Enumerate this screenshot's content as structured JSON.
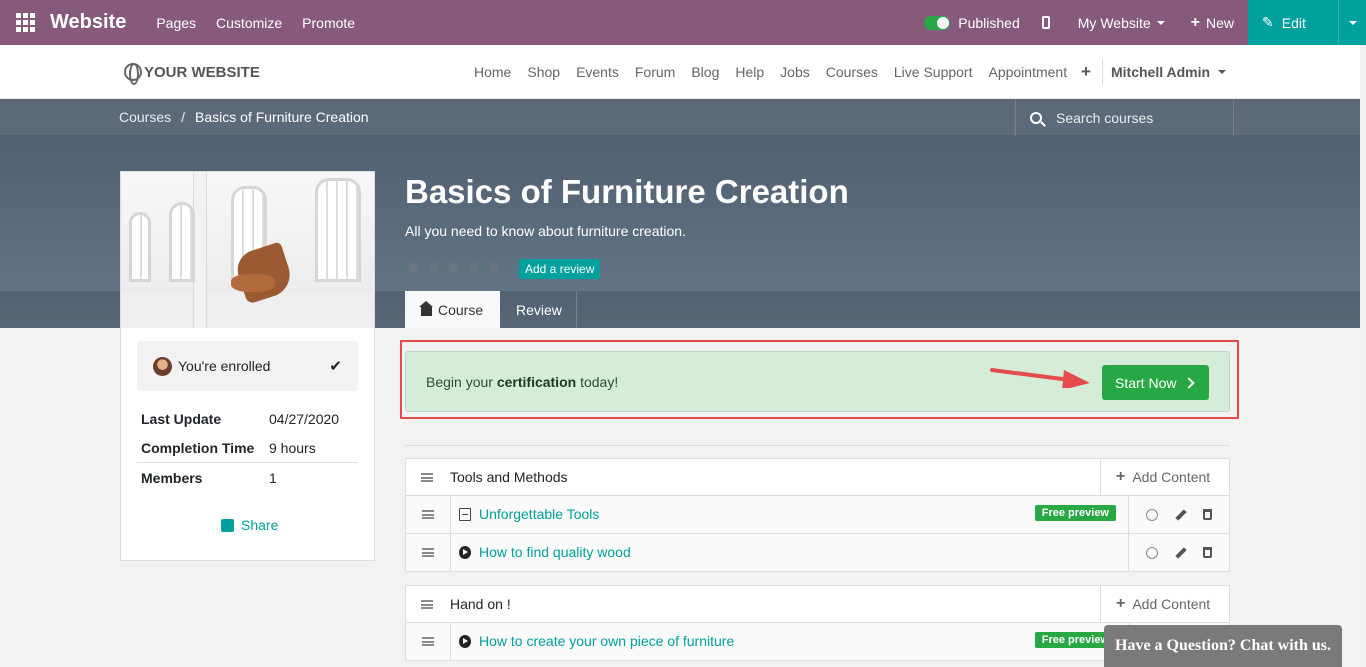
{
  "adminbar": {
    "app_name": "Website",
    "menu": [
      "Pages",
      "Customize",
      "Promote"
    ],
    "published_label": "Published",
    "my_website_label": "My Website",
    "new_label": "New",
    "edit_label": "Edit",
    "published": true
  },
  "sitenav": {
    "logo_text": "YOUR WEBSITE",
    "links": [
      "Home",
      "Shop",
      "Events",
      "Forum",
      "Blog",
      "Help",
      "Jobs",
      "Courses",
      "Live Support",
      "Appointment"
    ],
    "user_name": "Mitchell Admin"
  },
  "breadcrumb": {
    "root": "Courses",
    "separator": "/",
    "current": "Basics of Furniture Creation"
  },
  "search": {
    "placeholder": "Search courses"
  },
  "course": {
    "title": "Basics of Furniture Creation",
    "subtitle": "All you need to know about furniture creation.",
    "rating_stars": 0,
    "add_review_label": "Add a review",
    "tabs": [
      "Course",
      "Review"
    ]
  },
  "sidebar": {
    "enrolled_label": "You're enrolled",
    "meta": [
      {
        "key": "Last Update",
        "value": "04/27/2020"
      },
      {
        "key": "Completion Time",
        "value": "9 hours"
      },
      {
        "key": "Members",
        "value": "1"
      }
    ],
    "share_label": "Share"
  },
  "certification": {
    "text_before": "Begin your ",
    "text_bold": "certification",
    "text_after": " today!",
    "button_label": "Start Now"
  },
  "sections": [
    {
      "title": "Tools and Methods",
      "add_label": "Add Content",
      "lessons": [
        {
          "title": "Unforgettable Tools",
          "type": "pdf-icon",
          "badge": "Free preview"
        },
        {
          "title": "How to find quality wood",
          "type": "play-icon",
          "badge": ""
        }
      ]
    },
    {
      "title": "Hand on !",
      "add_label": "Add Content",
      "lessons": [
        {
          "title": "How to create your own piece of furniture",
          "type": "play-icon",
          "badge": "Free preview"
        }
      ]
    }
  ],
  "chat": {
    "label": "Have a Question? Chat with us."
  },
  "colors": {
    "admin_bar": "#875a7b",
    "primary": "#00a09d",
    "success": "#28a745",
    "highlight": "#e44c4c"
  }
}
